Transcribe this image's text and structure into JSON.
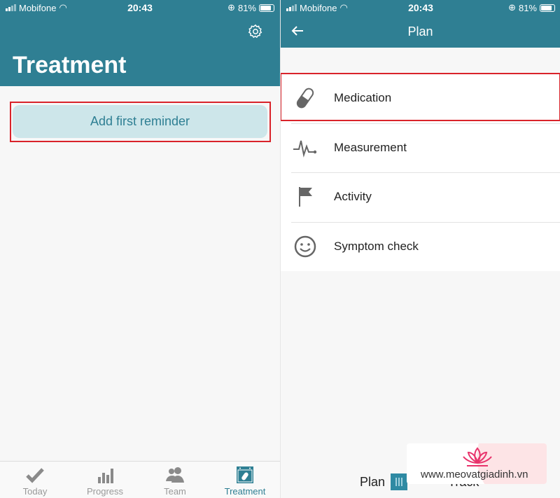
{
  "status_bar": {
    "carrier": "Mobifone",
    "time": "20:43",
    "battery": "81%"
  },
  "left": {
    "title": "Treatment",
    "add_button": "Add first reminder",
    "tabs": [
      {
        "label": "Today",
        "icon": "checkmark-icon"
      },
      {
        "label": "Progress",
        "icon": "bar-chart-icon"
      },
      {
        "label": "Team",
        "icon": "people-icon"
      },
      {
        "label": "Treatment",
        "icon": "calendar-pill-icon",
        "active": true
      }
    ]
  },
  "right": {
    "title": "Plan",
    "items": [
      {
        "label": "Medication",
        "icon": "pill-icon"
      },
      {
        "label": "Measurement",
        "icon": "pulse-icon"
      },
      {
        "label": "Activity",
        "icon": "flag-icon"
      },
      {
        "label": "Symptom check",
        "icon": "smiley-icon"
      }
    ],
    "toggle": {
      "left": "Plan",
      "right": "Track"
    }
  },
  "watermark": {
    "text": "www.meovatgiadinh.vn"
  },
  "colors": {
    "header": "#2f7f93",
    "accent": "#2e7f93",
    "highlight": "#d9232a"
  }
}
